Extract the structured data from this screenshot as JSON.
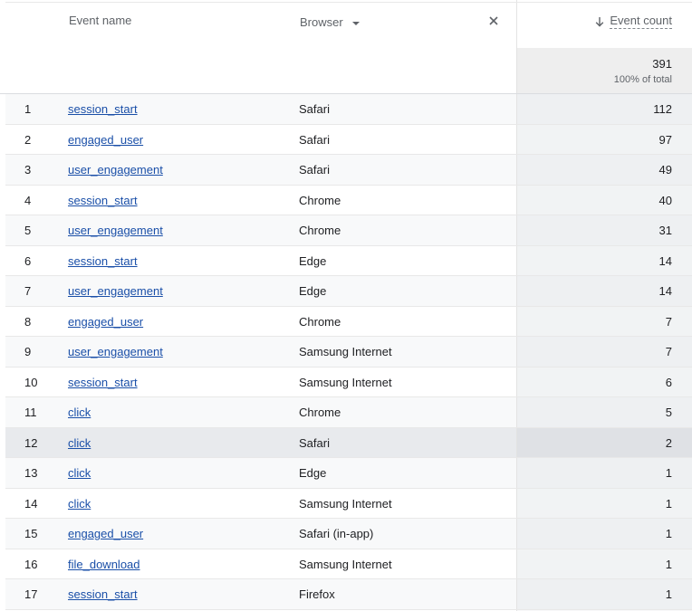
{
  "header": {
    "event_name": "Event name",
    "browser": "Browser",
    "event_count": "Event count"
  },
  "totals": {
    "value": "391",
    "percent": "100% of total"
  },
  "rows": [
    {
      "index": "1",
      "event": "session_start",
      "browser": "Safari",
      "count": "112"
    },
    {
      "index": "2",
      "event": "engaged_user",
      "browser": "Safari",
      "count": "97"
    },
    {
      "index": "3",
      "event": "user_engagement",
      "browser": "Safari",
      "count": "49"
    },
    {
      "index": "4",
      "event": "session_start",
      "browser": "Chrome",
      "count": "40"
    },
    {
      "index": "5",
      "event": "user_engagement",
      "browser": "Chrome",
      "count": "31"
    },
    {
      "index": "6",
      "event": "session_start",
      "browser": "Edge",
      "count": "14"
    },
    {
      "index": "7",
      "event": "user_engagement",
      "browser": "Edge",
      "count": "14"
    },
    {
      "index": "8",
      "event": "engaged_user",
      "browser": "Chrome",
      "count": "7"
    },
    {
      "index": "9",
      "event": "user_engagement",
      "browser": "Samsung Internet",
      "count": "7"
    },
    {
      "index": "10",
      "event": "session_start",
      "browser": "Samsung Internet",
      "count": "6"
    },
    {
      "index": "11",
      "event": "click",
      "browser": "Chrome",
      "count": "5"
    },
    {
      "index": "12",
      "event": "click",
      "browser": "Safari",
      "count": "2"
    },
    {
      "index": "13",
      "event": "click",
      "browser": "Edge",
      "count": "1"
    },
    {
      "index": "14",
      "event": "click",
      "browser": "Samsung Internet",
      "count": "1"
    },
    {
      "index": "15",
      "event": "engaged_user",
      "browser": "Safari (in-app)",
      "count": "1"
    },
    {
      "index": "16",
      "event": "file_download",
      "browser": "Samsung Internet",
      "count": "1"
    },
    {
      "index": "17",
      "event": "session_start",
      "browser": "Firefox",
      "count": "1"
    }
  ],
  "colors": {
    "link": "#1a4fa8",
    "highlight_row": "#e8eaed"
  },
  "icons": {
    "sort": "arrow-down-icon",
    "remove": "close-icon",
    "dropdown": "caret-down-icon"
  }
}
